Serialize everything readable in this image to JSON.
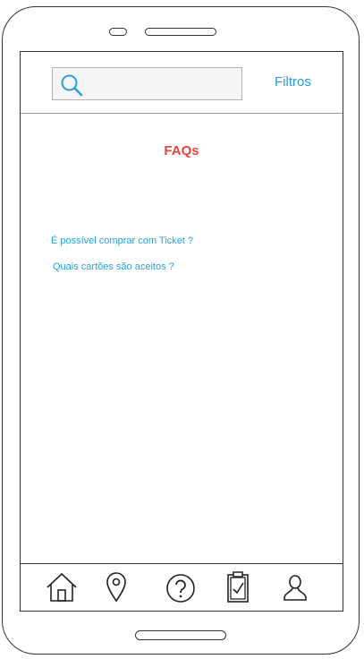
{
  "search": {
    "placeholder": ""
  },
  "header": {
    "filters_label": "Filtros"
  },
  "page": {
    "title": "FAQs"
  },
  "faq": {
    "items": [
      {
        "question": "É possível comprar com Ticket ?"
      },
      {
        "question": "Quais cartões são aceitos ?"
      }
    ]
  },
  "nav": {
    "items": [
      {
        "icon": "home-icon"
      },
      {
        "icon": "location-pin-icon"
      },
      {
        "icon": "help-icon"
      },
      {
        "icon": "clipboard-check-icon"
      },
      {
        "icon": "user-icon"
      }
    ]
  },
  "colors": {
    "accent": "#2aa0d9",
    "title": "#e5463d"
  }
}
